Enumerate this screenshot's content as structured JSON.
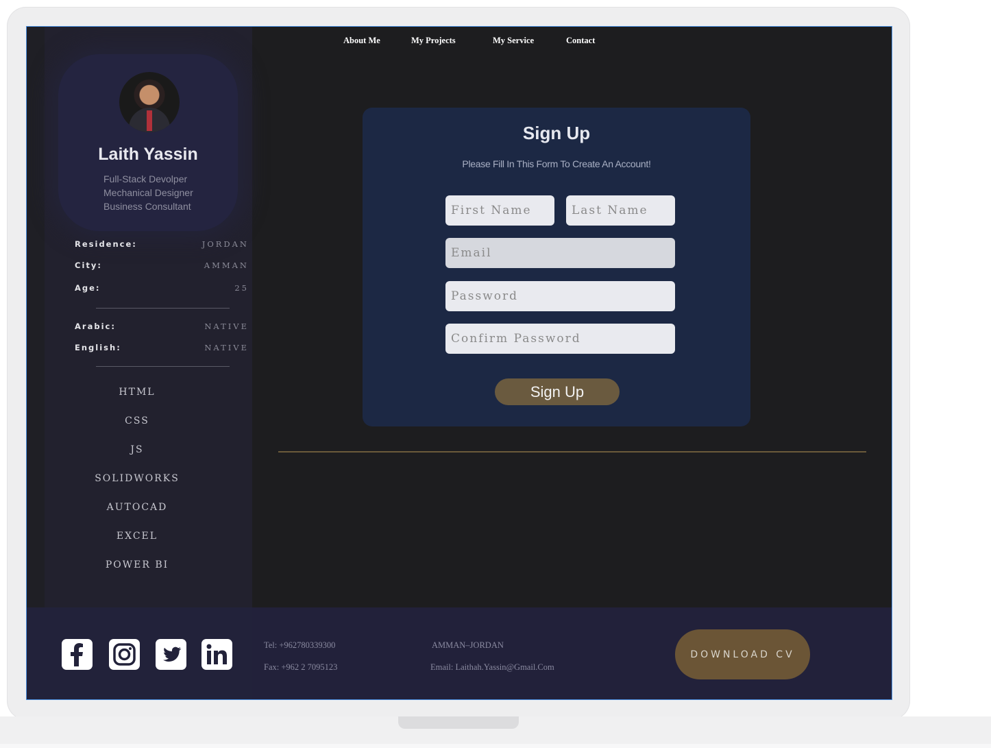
{
  "nav": {
    "about": "About Me",
    "projects": "My Projects",
    "service": "My Service",
    "contact": "Contact"
  },
  "profile": {
    "name": "Laith Yassin",
    "roles": [
      "Full-Stack Devolper",
      "Mechanical Designer",
      "Business Consultant"
    ]
  },
  "info": [
    {
      "key": "Residence:",
      "value": "JORDAN"
    },
    {
      "key": "City:",
      "value": "AMMAN"
    },
    {
      "key": "Age:",
      "value": "25"
    }
  ],
  "languages": [
    {
      "key": "Arabic:",
      "value": "NATIVE"
    },
    {
      "key": "English:",
      "value": "NATIVE"
    }
  ],
  "skills": [
    "HTML",
    "CSS",
    "JS",
    "SOLIDWORKS",
    "AUTOCAD",
    "EXCEL",
    "POWER BI"
  ],
  "form": {
    "title": "Sign Up",
    "subtitle": "Please Fill In This Form To Create An Account!",
    "first_name_placeholder": "First Name",
    "last_name_placeholder": "Last Name",
    "email_placeholder": "Email",
    "password_placeholder": "Password",
    "confirm_placeholder": "Confirm Password",
    "submit_label": "Sign Up"
  },
  "footer": {
    "tel": "Tel: +962780339300",
    "fax": "Fax: +962 2 7095123",
    "location": "AMMAN–JORDAN",
    "email_label": "Email:",
    "email": "Laithah.Yassin@Gmail.Com",
    "download_label": "DOWNLOAD CV"
  },
  "colors": {
    "accent_gold": "#6b5536",
    "card_bg": "#1c2844",
    "sidebar_bg": "#22212e",
    "screen_bg": "#1d1d1f"
  },
  "icons": [
    "facebook-icon",
    "instagram-icon",
    "twitter-icon",
    "linkedin-icon"
  ]
}
